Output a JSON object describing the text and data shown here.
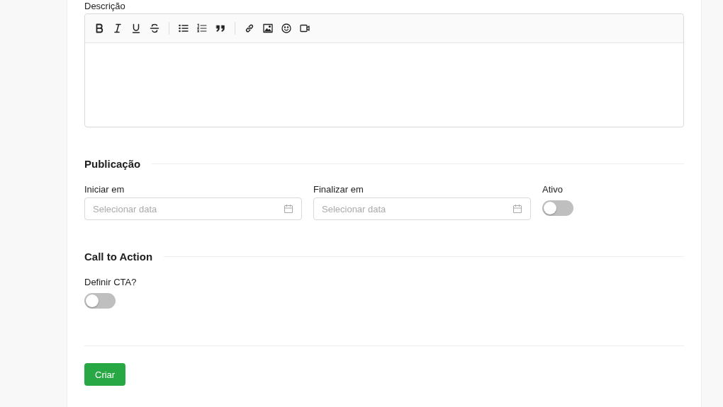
{
  "description": {
    "label": "Descrição",
    "toolbar_groups": [
      [
        {
          "kind": "bold"
        },
        {
          "kind": "italic"
        },
        {
          "kind": "underline"
        },
        {
          "kind": "strike"
        }
      ],
      [
        {
          "kind": "bullet-list"
        },
        {
          "kind": "ordered-list"
        },
        {
          "kind": "quote"
        }
      ],
      [
        {
          "kind": "link"
        },
        {
          "kind": "image"
        },
        {
          "kind": "emoji"
        },
        {
          "kind": "video"
        }
      ]
    ]
  },
  "sections": [
    {
      "title": "Publicação",
      "fields": [
        {
          "kind": "date",
          "label": "Iniciar em",
          "placeholder": "Selecionar data"
        },
        {
          "kind": "date",
          "label": "Finalizar em",
          "placeholder": "Selecionar data"
        },
        {
          "kind": "toggle",
          "label": "Ativo",
          "on": false
        }
      ]
    },
    {
      "title": "Call to Action",
      "fields": [
        {
          "kind": "toggle",
          "label": "Definir CTA?",
          "on": false
        }
      ]
    }
  ],
  "submit": {
    "label": "Criar"
  }
}
